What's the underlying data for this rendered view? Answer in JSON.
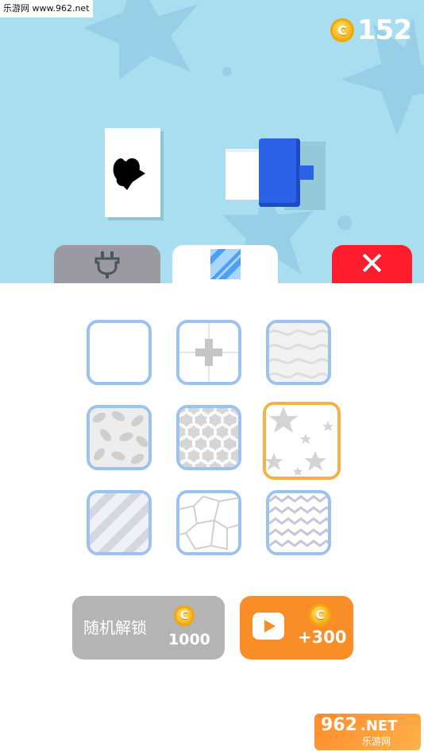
{
  "watermark_top": "乐游网 www.962.net",
  "currency": {
    "icon": "coin-icon",
    "coin_glyph": "C",
    "amount": "152"
  },
  "scene": {
    "socket_icon": "heart-icon",
    "plug_color": "#2b62e8",
    "background_color": "#a9def0"
  },
  "tabs": [
    {
      "name": "plug",
      "icon": "plug-icon",
      "color": "#9a9aa0"
    },
    {
      "name": "pattern",
      "icon": "stripes-icon",
      "color": "#ffffff",
      "active": true
    },
    {
      "name": "close",
      "icon": "close-icon",
      "glyph": "✕",
      "color": "#ff1d2d"
    }
  ],
  "patterns": [
    {
      "name": "blank"
    },
    {
      "name": "plus"
    },
    {
      "name": "clouds"
    },
    {
      "name": "leaves"
    },
    {
      "name": "circles"
    },
    {
      "name": "stars",
      "selected": true
    },
    {
      "name": "stripes"
    },
    {
      "name": "cracks"
    },
    {
      "name": "zigzag"
    }
  ],
  "buttons": {
    "random_unlock": {
      "label": "随机解锁",
      "price": "1000",
      "icon": "coin-icon"
    },
    "watch_video": {
      "icon": "play-icon",
      "reward": "+300"
    }
  },
  "colors": {
    "tile_border": "#9cc3ef",
    "selected_border": "#f5b243",
    "accent_orange": "#f98d28"
  },
  "watermark_bottom": {
    "logo": "962",
    "suffix": ".NET",
    "subtitle": "乐游网"
  }
}
